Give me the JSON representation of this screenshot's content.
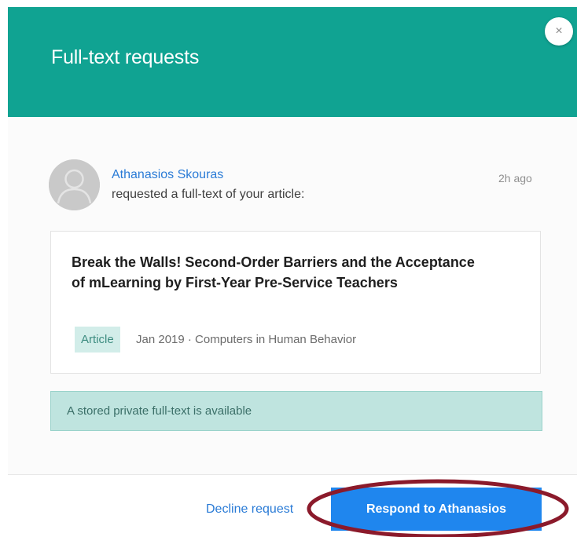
{
  "header": {
    "title": "Full-text requests",
    "close_glyph": "×",
    "background_color": "#10a392"
  },
  "request": {
    "requester_name": "Athanasios Skouras",
    "action_text": "requested a full-text of your article:",
    "time_ago": "2h ago",
    "avatar_icon": "user-silhouette-icon"
  },
  "article": {
    "title": "Break the Walls! Second-Order Barriers and the Acceptance of mLearning by First-Year Pre-Service Teachers",
    "type_badge": "Article",
    "meta": "Jan 2019 · Computers in Human Behavior"
  },
  "notice": {
    "text": "A stored private full-text is available"
  },
  "footer": {
    "decline_label": "Decline request",
    "respond_label": "Respond to Athanasios",
    "accent_color": "#1f86ee",
    "highlight_color": "#8b1a2b"
  }
}
